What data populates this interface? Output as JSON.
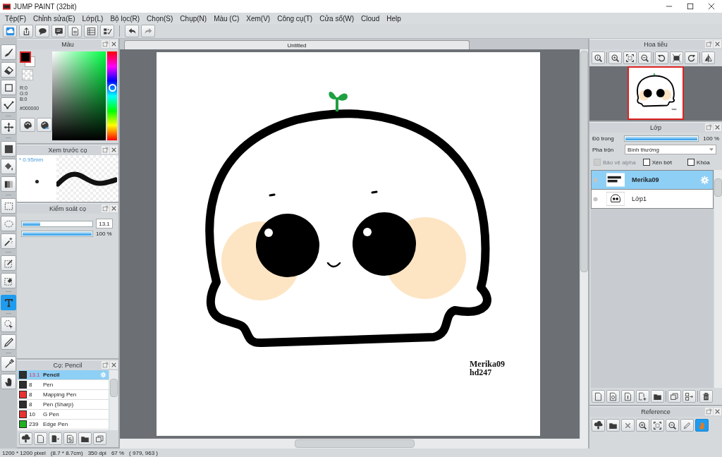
{
  "window": {
    "title": "JUMP PAINT (32bit)"
  },
  "menu": [
    "Tệp(F)",
    "Chỉnh sửa(E)",
    "Lớp(L)",
    "Bộ lọc(R)",
    "Chọn(S)",
    "Chụp(N)",
    "Màu (C)",
    "Xem(V)",
    "Công cụ(T)",
    "Cửa sổ(W)",
    "Cloud",
    "Help"
  ],
  "tools": [
    {
      "selected": false
    },
    {
      "selected": false
    },
    {
      "selected": false
    },
    {
      "selected": false
    },
    {
      "selected": false
    },
    {
      "selected": false
    },
    {
      "selected": false
    },
    {
      "selected": false
    },
    {
      "selected": false
    },
    {
      "selected": false
    },
    {
      "selected": false
    },
    {
      "selected": false
    },
    {
      "selected": false
    },
    {
      "selected": true
    },
    {
      "selected": false
    },
    {
      "selected": false
    },
    {
      "selected": false
    },
    {
      "selected": false
    }
  ],
  "color_panel": {
    "title": "Màu",
    "r": "R:0",
    "g": "G:0",
    "b": "B:0",
    "hex": "#000000",
    "hue": {
      "level": 0.6
    }
  },
  "brush_preview": {
    "title": "Xem trước cọ",
    "size": "* 0.95mm"
  },
  "brush_control": {
    "title": "Kiểm soát cọ",
    "size": {
      "level": 0.25,
      "reading": "13.1"
    },
    "opacity": {
      "level": 1,
      "reading": "100 %"
    }
  },
  "brush_list": {
    "title": "Cọ: Pencil",
    "items": [
      {
        "size": "13.1",
        "name": "Pencil",
        "color": "#2e2e2e",
        "selected": true
      },
      {
        "size": "8",
        "name": "Pen",
        "color": "#2e2e2e",
        "selected": false
      },
      {
        "size": "8",
        "name": "Mapping Pen",
        "color": "#e83232",
        "selected": false
      },
      {
        "size": "8",
        "name": "Pen (Sharp)",
        "color": "#2e2e2e",
        "selected": false
      },
      {
        "size": "10",
        "name": "G Pen",
        "color": "#e83232",
        "selected": false
      },
      {
        "size": "239",
        "name": "Edge Pen",
        "color": "#22b022",
        "selected": false
      }
    ]
  },
  "document": {
    "tab": "Untitled",
    "signature": [
      "Merika09",
      "hd247"
    ]
  },
  "navigator": {
    "title": "Hoa tiêu"
  },
  "layers": {
    "title": "Lớp",
    "opacity_label": "Độ trong",
    "opacity": {
      "level": 1,
      "reading": "100 %"
    },
    "blend_label": "Pha trộn",
    "blend_value": "Bình thường",
    "options": [
      {
        "label": "Bảo vệ alpha",
        "checked": false,
        "disabled": true
      },
      {
        "label": "Xén bớt",
        "checked": false,
        "disabled": false
      },
      {
        "label": "Khóa",
        "checked": false,
        "disabled": false
      }
    ],
    "items": [
      {
        "name": "Merika09",
        "selected": true,
        "kind": "text"
      },
      {
        "name": "Lớp1",
        "selected": false,
        "kind": "drawing"
      }
    ]
  },
  "reference": {
    "title": "Reference",
    "tools": [
      {
        "selected": false
      },
      {
        "selected": false
      },
      {
        "selected": false
      },
      {
        "selected": false
      },
      {
        "selected": false
      },
      {
        "selected": false
      },
      {
        "selected": false
      },
      {
        "selected": true
      }
    ]
  },
  "status_bar": [
    "1200 * 1200 pixel",
    "(8.7 * 8.7cm)",
    "350 dpi",
    "67 %",
    "( 979, 963 )"
  ]
}
